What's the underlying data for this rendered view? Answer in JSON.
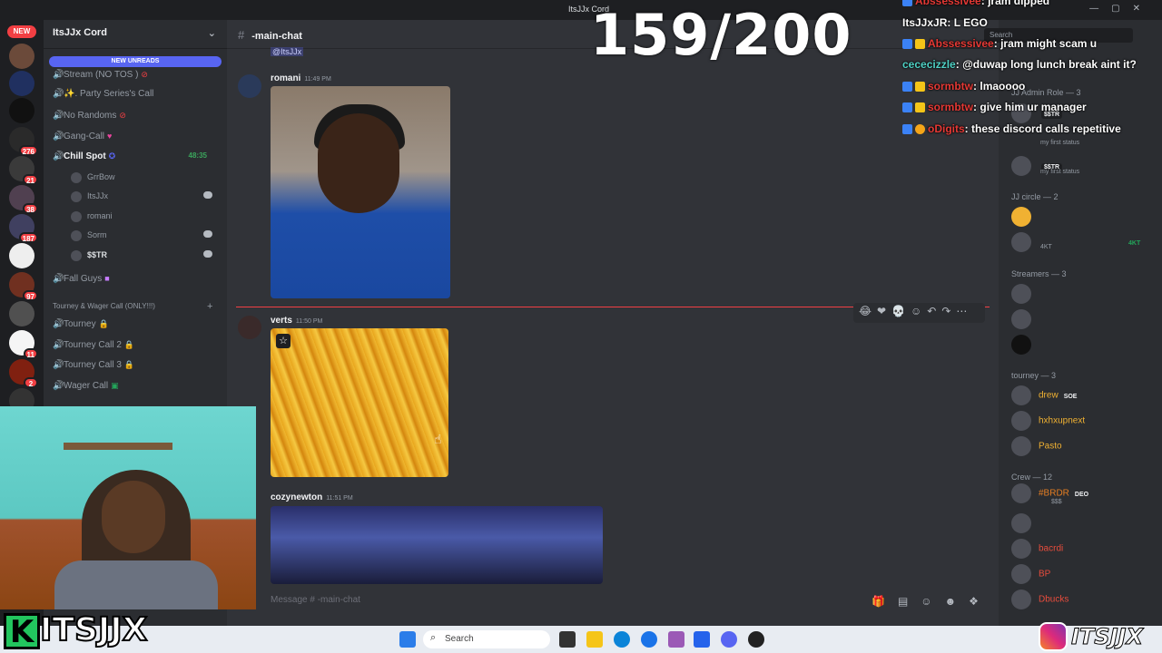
{
  "window": {
    "title": "ItsJJx Cord",
    "controls": [
      "—",
      "▢",
      "✕"
    ],
    "search_placeholder": "Search"
  },
  "counter": {
    "text": "159/200"
  },
  "rail": {
    "new_pill": "NEW",
    "badges": [
      "276",
      "21",
      "38",
      "187",
      "97",
      "11",
      "2"
    ]
  },
  "server": {
    "name": "ItsJJx Cord",
    "new_unreads": "NEW UNREADS"
  },
  "channels": {
    "stream": "Stream (NO TOS )",
    "party": "✨. Party Series's Call",
    "no_randoms": "No Randoms",
    "gang_call": "Gang-Call",
    "chill_spot": "Chill Spot",
    "chill_timer": "48:35",
    "chill_members": [
      "GrrBow",
      "ItsJJx",
      "romani",
      "Sorm",
      "$$TR"
    ],
    "fall_guys": "Fall Guys",
    "category_tourney": "Tourney & Wager Call (ONLY!!!)",
    "tourney": "Tourney",
    "tourney2": "Tourney Call 2",
    "tourney3": "Tourney Call 3",
    "wager": "Wager Call"
  },
  "chat": {
    "channel": "-main-chat",
    "mention": "@ItsJJx",
    "messages": [
      {
        "author": "romani",
        "time": "11:49 PM"
      },
      {
        "author": "verts",
        "time": "11:50 PM"
      },
      {
        "author": "cozynewton",
        "time": "11:51 PM"
      }
    ],
    "composer_placeholder": "Message # -main-chat"
  },
  "members": {
    "admin_role": "JJ Admin Role — 3",
    "admin_status": "my first status",
    "admin_tag": "$$TR",
    "jj_circle": "JJ circle — 2",
    "circle_tag": "4KT",
    "circle_sub": "4KT",
    "streamers": "Streamers — 3",
    "tourney_cat": "tourney — 3",
    "tourney_members": [
      {
        "name": "drew",
        "tag": "SOE",
        "color": "#f0b132"
      },
      {
        "name": "hxhxupnext",
        "tag": "",
        "color": "#f0b132"
      },
      {
        "name": "Pasto",
        "tag": "",
        "color": "#f0b132"
      }
    ],
    "crew": "Crew — 12",
    "crew_members": [
      {
        "name": "#BRDR",
        "tag": "DEO",
        "sub": "$$$",
        "color": "#e67e22"
      },
      {
        "name": "bacrdi",
        "tag": "",
        "sub": "",
        "color": "#e74c3c"
      },
      {
        "name": "BP",
        "tag": "",
        "sub": "",
        "color": "#e74c3c"
      },
      {
        "name": "Dbucks",
        "tag": "",
        "sub": "",
        "color": "#e74c3c"
      }
    ]
  },
  "stream_chat": [
    {
      "user": "Abssessivee",
      "text": "jram dipped",
      "color": "#e53935"
    },
    {
      "user": "ItsJJxJR",
      "text": "L EGO",
      "color": "#ffffff"
    },
    {
      "user": "Abssessivee",
      "text": "jram might scam u",
      "color": "#e53935"
    },
    {
      "user": "cececizzle",
      "text": "@duwap long lunch break aint it?",
      "color": "#4fd1c5"
    },
    {
      "user": "sormbtw",
      "text": "lmaoooo",
      "color": "#e53935"
    },
    {
      "user": "sormbtw",
      "text": "give him ur manager",
      "color": "#e53935"
    },
    {
      "user": "oDigits",
      "text": "these discord calls repetitive",
      "color": "#e53935"
    }
  ],
  "taskbar": {
    "search": "Search"
  },
  "logos": {
    "left_k": "K",
    "left_text": "ITSJJX",
    "right_text": "ITSJJX"
  },
  "colors": {
    "discord_bg": "#313338",
    "accent": "#5865f2",
    "danger": "#f23f43",
    "online": "#23a55a"
  }
}
